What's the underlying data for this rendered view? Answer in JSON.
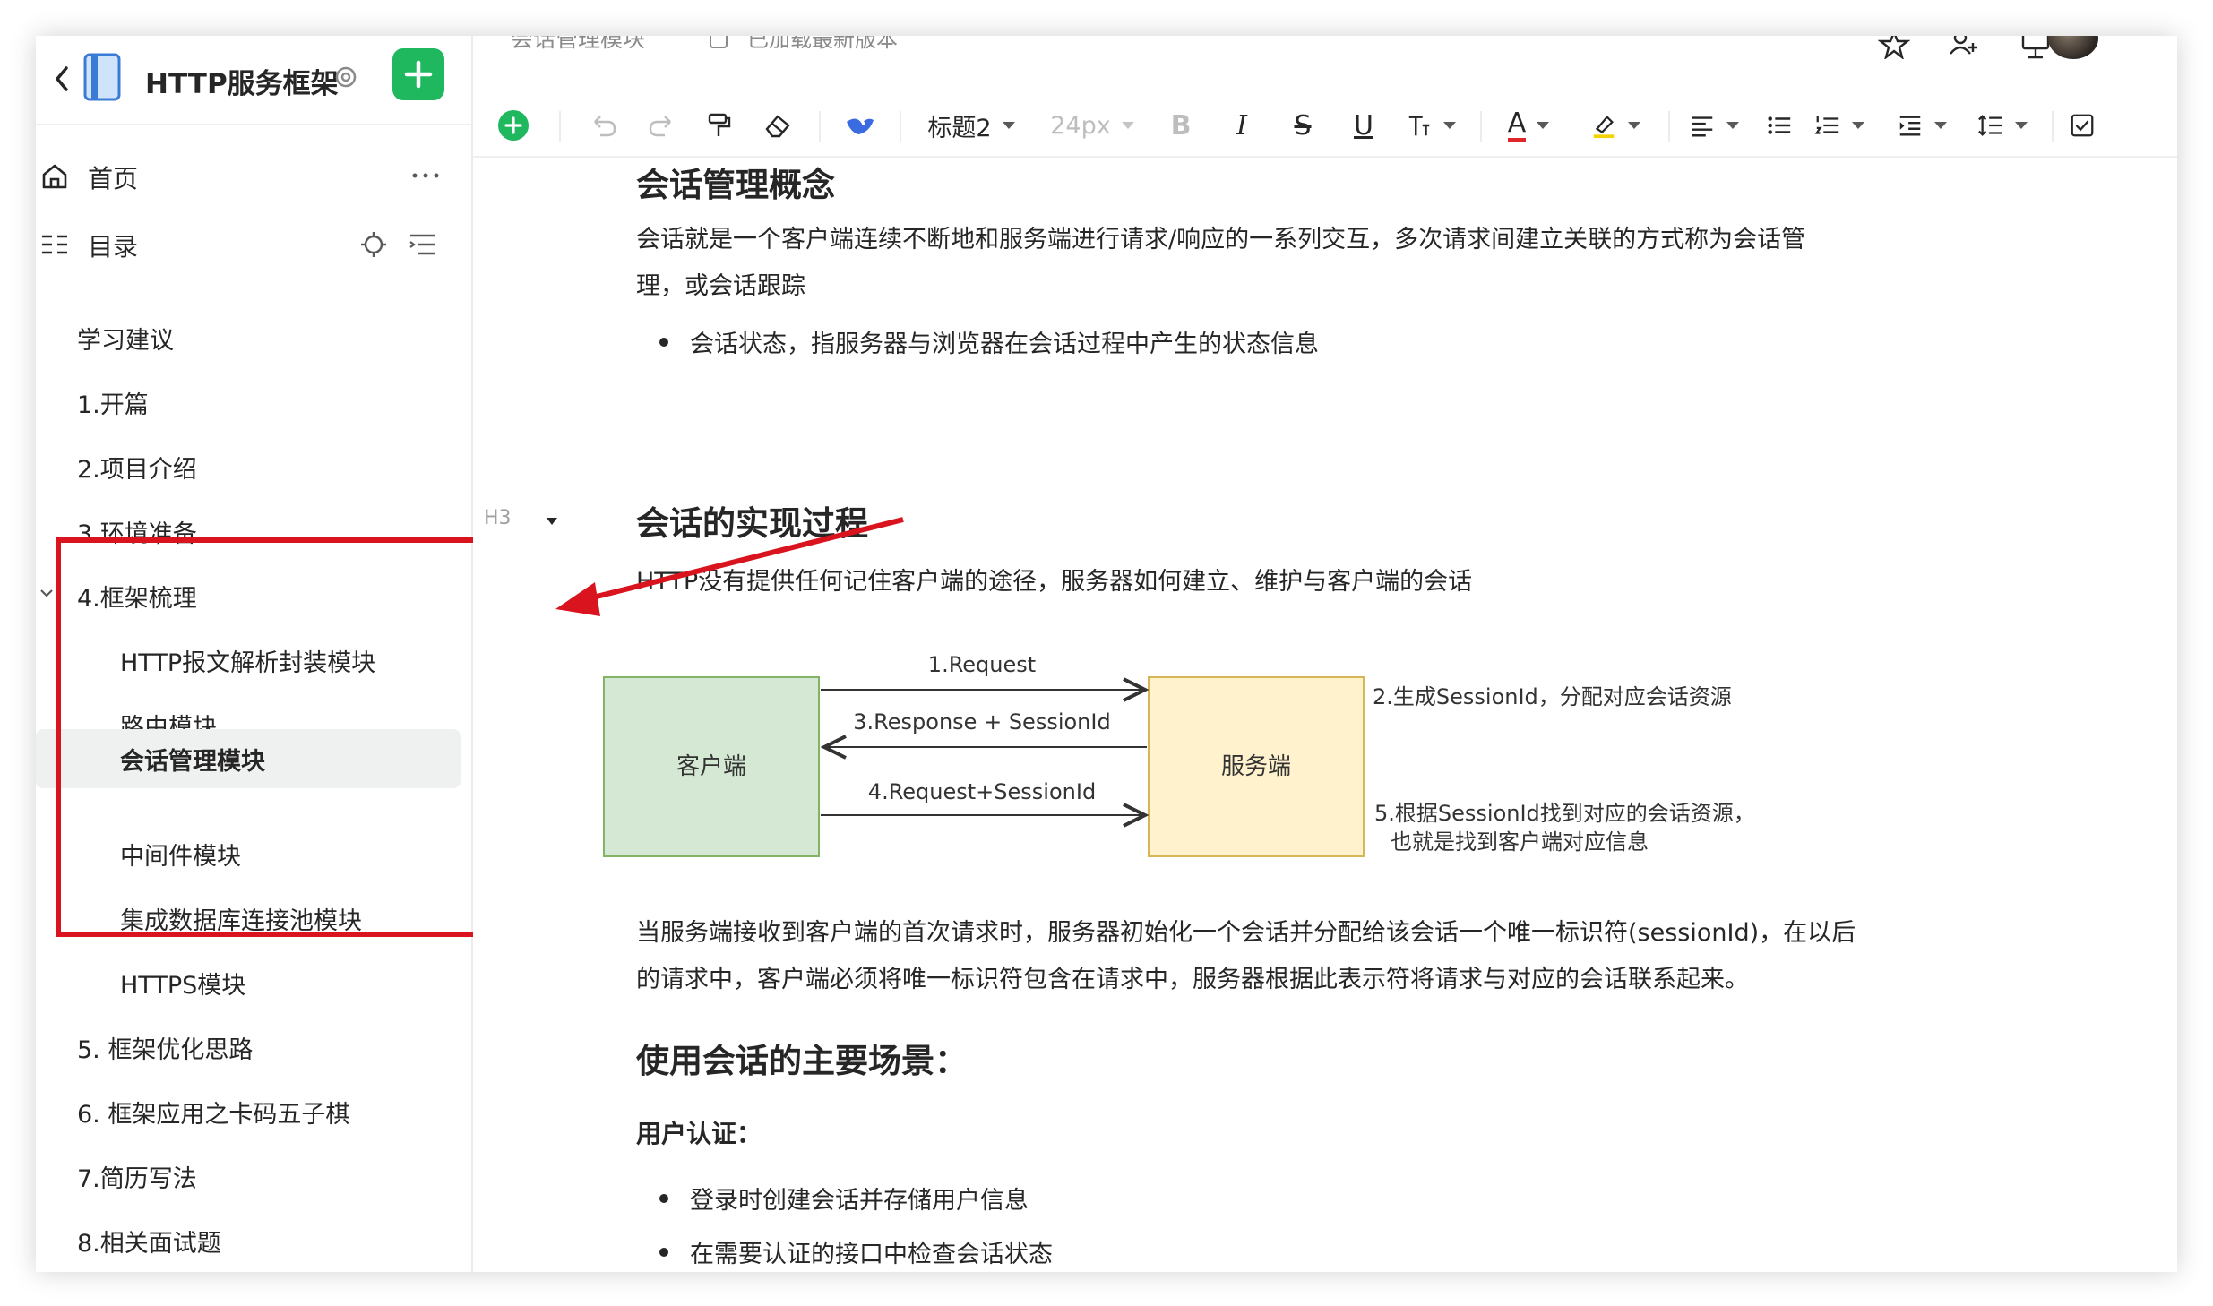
{
  "sidebar": {
    "kb_title": "HTTP服务框架",
    "home_label": "首页",
    "toc_label": "目录",
    "toc_items": [
      "学习建议",
      "1.开篇",
      "2.项目介绍",
      "3.环境准备",
      "4.框架梳理",
      "HTTP报文解析封装模块",
      "路由模块",
      "会话管理模块",
      "中间件模块",
      "集成数据库连接池模块",
      "HTTPS模块",
      "5. 框架优化思路",
      "6. 框架应用之卡码五子棋",
      "7.简历写法",
      "8.相关面试题"
    ],
    "selected_item": "会话管理模块"
  },
  "header": {
    "breadcrumb": "会话管理模块",
    "status": "已加载最新版本"
  },
  "toolbar": {
    "heading_style": "标题2",
    "font_size": "24px",
    "bold": "B",
    "italic": "I",
    "strike": "S",
    "underline": "U",
    "font_color": "A"
  },
  "doc": {
    "h_concept": "会话管理概念",
    "p1_line1": "会话就是一个客户端连续不断地和服务端进行请求/响应的一系列交互，多次请求间建立关联的方式称为会话管",
    "p1_line2": "理，或会话跟踪",
    "bullet1": "会话状态，指服务器与浏览器在会话过程中产生的状态信息",
    "h3_tag": "H3",
    "h_process": "会话的实现过程",
    "p2": "HTTP没有提供任何记住客户端的途径，服务器如何建立、维护与客户端的会话",
    "diagram": {
      "client": "客户端",
      "server": "服务端",
      "arrow1": "1.Request",
      "arrow3": "3.Response + SessionId",
      "arrow4": "4.Request+SessionId",
      "note2": "2.生成SessionId，分配对应会话资源",
      "note5_line1": "5.根据SessionId找到对应的会话资源，",
      "note5_line2": "也就是找到客户端对应信息"
    },
    "p3_line1": "当服务端接收到客户端的首次请求时，服务器初始化一个会话并分配给该会话一个唯一标识符(sessionId)，在以后",
    "p3_line2": "的请求中，客户端必须将唯一标识符包含在请求中，服务器根据此表示符将请求与对应的会话联系起来。",
    "h_scenes": "使用会话的主要场景：",
    "label_auth": "用户认证：",
    "bullet_auth1": "登录时创建会话并存储用户信息",
    "bullet_auth2": "在需要认证的接口中检查会话状态"
  },
  "colors": {
    "accent_green": "#1fb85f",
    "annotation_red": "#d9141f",
    "client_box": "#d5e8d4",
    "server_box": "#fff2cc"
  }
}
